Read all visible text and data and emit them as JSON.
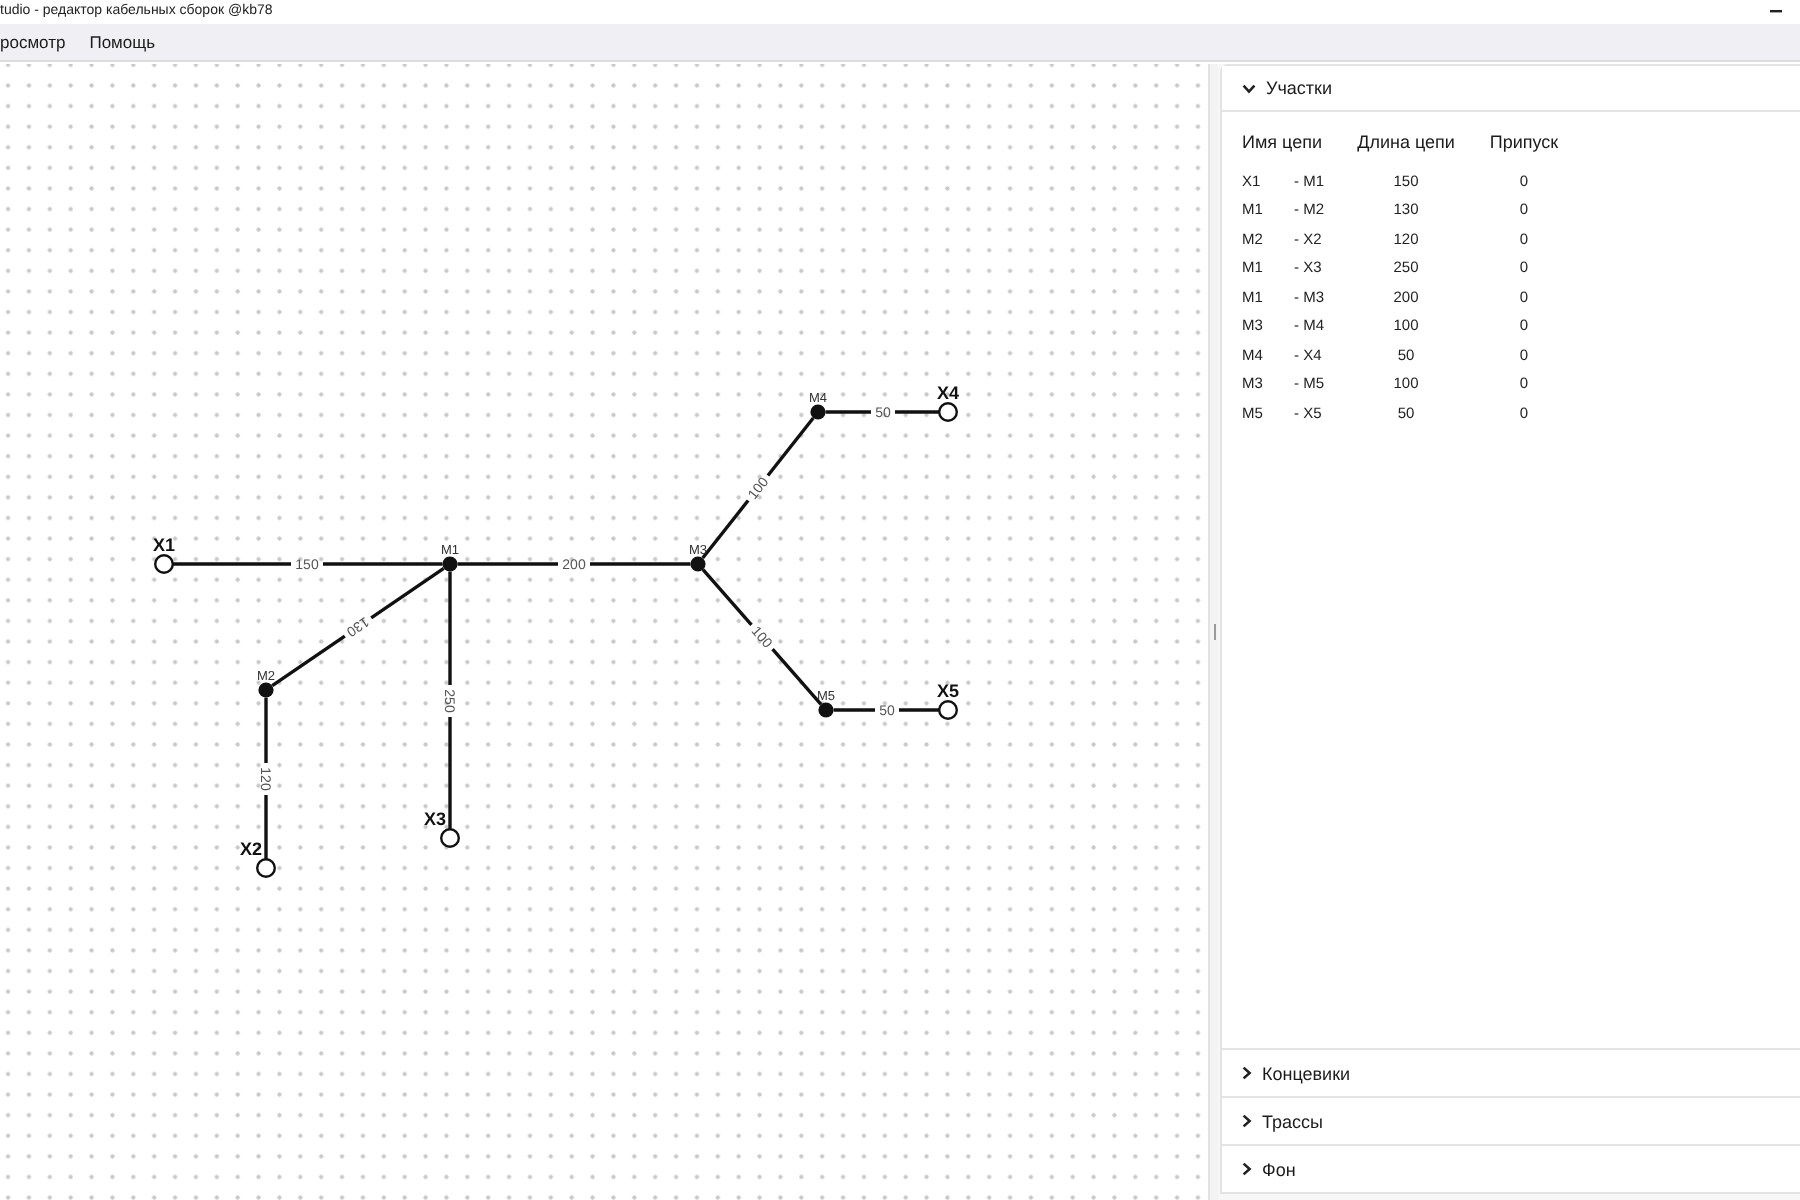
{
  "window": {
    "title": "tudio - редактор кабельных сборок @kb78"
  },
  "menu": [
    {
      "label": "росмотр"
    },
    {
      "label": "Помощь"
    }
  ],
  "diagram": {
    "nodes": [
      {
        "label": "X1",
        "kind": "terminal"
      },
      {
        "label": "M1",
        "kind": "junction"
      },
      {
        "label": "M2",
        "kind": "junction"
      },
      {
        "label": "X2",
        "kind": "terminal"
      },
      {
        "label": "X3",
        "kind": "terminal"
      },
      {
        "label": "M3",
        "kind": "junction"
      },
      {
        "label": "M4",
        "kind": "junction"
      },
      {
        "label": "X4",
        "kind": "terminal"
      },
      {
        "label": "M5",
        "kind": "junction"
      },
      {
        "label": "X5",
        "kind": "terminal"
      }
    ],
    "edges": [
      {
        "label": "150"
      },
      {
        "label": "130"
      },
      {
        "label": "120"
      },
      {
        "label": "250"
      },
      {
        "label": "200"
      },
      {
        "label": "100"
      },
      {
        "label": "50"
      },
      {
        "label": "100"
      },
      {
        "label": "50"
      }
    ]
  },
  "panel": {
    "sections": [
      {
        "title": "Участки",
        "expanded": true,
        "table": {
          "columns": [
            "Имя цепи",
            "Длина цепи",
            "Припуск"
          ],
          "rows": [
            {
              "from": "X1",
              "to": "- M1",
              "length": "150",
              "allowance": "0"
            },
            {
              "from": "M1",
              "to": "- M2",
              "length": "130",
              "allowance": "0"
            },
            {
              "from": "M2",
              "to": "- X2",
              "length": "120",
              "allowance": "0"
            },
            {
              "from": "M1",
              "to": "- X3",
              "length": "250",
              "allowance": "0"
            },
            {
              "from": "M1",
              "to": "- M3",
              "length": "200",
              "allowance": "0"
            },
            {
              "from": "M3",
              "to": "- M4",
              "length": "100",
              "allowance": "0"
            },
            {
              "from": "M4",
              "to": "- X4",
              "length": "50",
              "allowance": "0"
            },
            {
              "from": "M3",
              "to": "- M5",
              "length": "100",
              "allowance": "0"
            },
            {
              "from": "M5",
              "to": "- X5",
              "length": "50",
              "allowance": "0"
            }
          ]
        }
      },
      {
        "title": "Концевики",
        "expanded": false
      },
      {
        "title": "Трассы",
        "expanded": false
      },
      {
        "title": "Фон",
        "expanded": false
      }
    ]
  }
}
